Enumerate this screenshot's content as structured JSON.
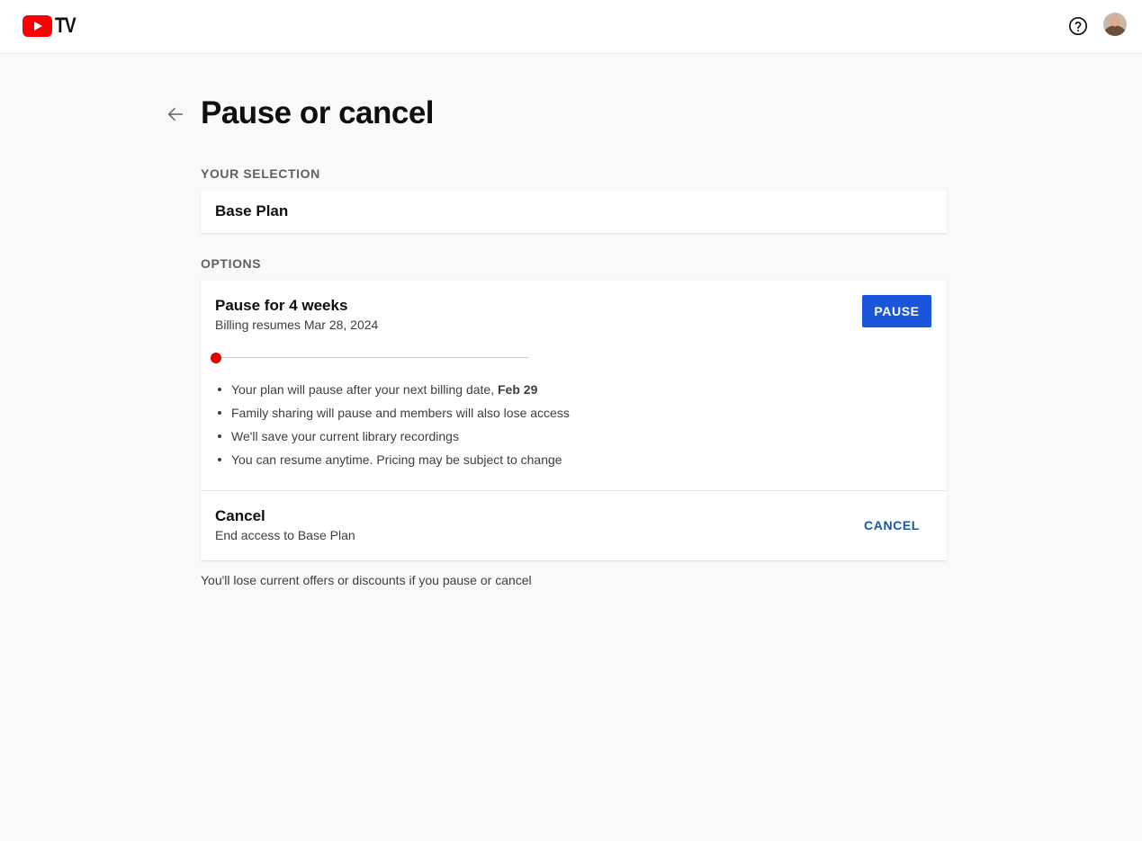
{
  "header": {
    "logo_text": "TV",
    "help_icon": "help-circle-icon",
    "avatar_icon": "user-avatar"
  },
  "page": {
    "back_icon": "arrow-left-icon",
    "title": "Pause or cancel"
  },
  "selection": {
    "label": "YOUR SELECTION",
    "value": "Base Plan"
  },
  "options": {
    "label": "OPTIONS",
    "pause": {
      "title": "Pause for 4 weeks",
      "subtitle": "Billing resumes Mar 28, 2024",
      "button_label": "PAUSE",
      "slider_level": 0,
      "bullets": [
        {
          "text": "Your plan will pause after your next billing date, ",
          "bold": "Feb 29"
        },
        {
          "text": "Family sharing will pause and members will also lose access",
          "bold": ""
        },
        {
          "text": "We'll save your current library recordings",
          "bold": ""
        },
        {
          "text": "You can resume anytime. Pricing may be subject to change",
          "bold": ""
        }
      ]
    },
    "cancel": {
      "title": "Cancel",
      "subtitle": "End access to Base Plan",
      "button_label": "CANCEL"
    }
  },
  "footnote": "You'll lose current offers or discounts if you pause or cancel",
  "colors": {
    "brand_red": "#ff0000",
    "primary_button": "#1a56db",
    "link_blue": "#1a56a8",
    "slider_thumb": "#e60000"
  }
}
